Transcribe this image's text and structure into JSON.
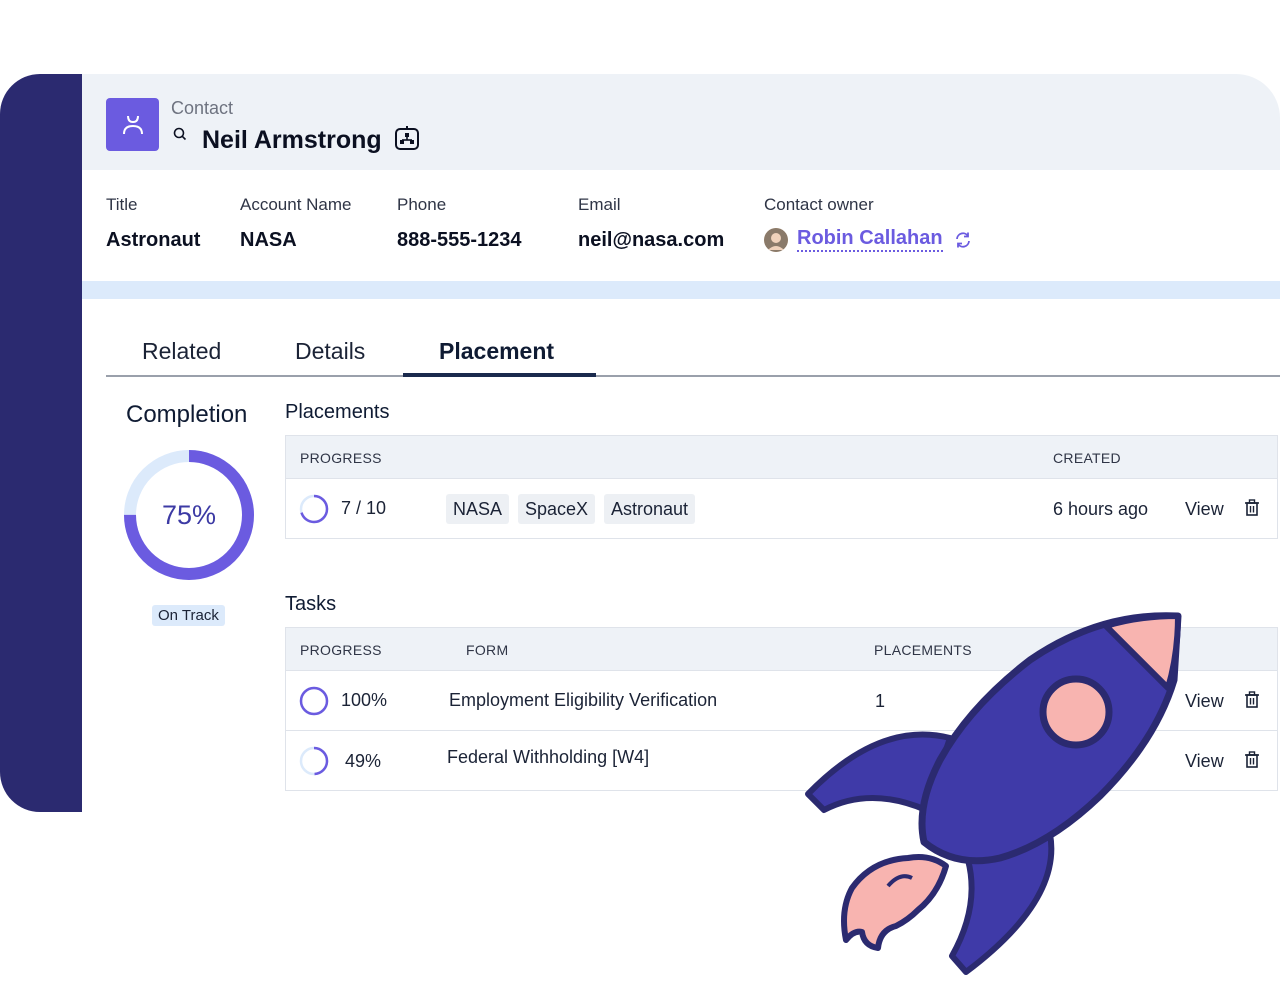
{
  "header": {
    "object_label": "Contact",
    "contact_name": "Neil Armstrong",
    "icons": [
      "contact-avatar-icon",
      "search-icon",
      "org-chart-icon"
    ]
  },
  "fields": [
    {
      "label": "Title",
      "value": "Astronaut"
    },
    {
      "label": "Account Name",
      "value": "NASA"
    },
    {
      "label": "Phone",
      "value": "888-555-1234"
    },
    {
      "label": "Email",
      "value": "neil@nasa.com"
    }
  ],
  "owner": {
    "label": "Contact owner",
    "name": "Robin Callahan",
    "icon": "refresh-icon"
  },
  "tabs": [
    {
      "label": "Related",
      "active": false
    },
    {
      "label": "Details",
      "active": false
    },
    {
      "label": "Placement",
      "active": true
    }
  ],
  "completion": {
    "title": "Completion",
    "percent": 75,
    "percent_label": "75%",
    "status": "On Track"
  },
  "placements": {
    "title": "Placements",
    "columns": {
      "progress": "PROGRESS",
      "created": "CREATED"
    },
    "rows": [
      {
        "progress_label": "7 / 10",
        "progress": 0.7,
        "tags": [
          "NASA",
          "SpaceX",
          "Astronaut"
        ],
        "created": "6 hours ago",
        "action": "View"
      }
    ]
  },
  "tasks": {
    "title": "Tasks",
    "columns": {
      "progress": "PROGRESS",
      "form": "FORM",
      "placements": "PLACEMENTS"
    },
    "rows": [
      {
        "progress_label": "100%",
        "progress": 1.0,
        "form": "Employment Eligibility Verification",
        "placements": "1",
        "action": "View"
      },
      {
        "progress_label": "49%",
        "progress": 0.49,
        "form": "Federal Withholding [W4]",
        "placements": "",
        "action": "View"
      }
    ]
  },
  "colors": {
    "accent": "#6b5be0",
    "sidebar": "#2b2a70",
    "ring_track": "#dceafb",
    "rocket_body": "#3f3aa8",
    "rocket_pink": "#f8b4b0",
    "rocket_outline": "#2b2a70"
  },
  "decoration": {
    "icon": "rocket-illustration"
  }
}
